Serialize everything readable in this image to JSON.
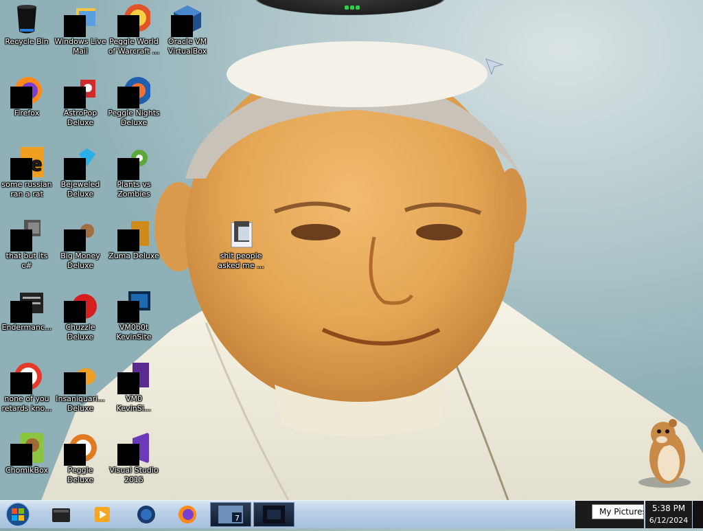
{
  "desktop": {
    "icons": [
      {
        "label": "Recycle Bin"
      },
      {
        "label": "Windows Live Mail"
      },
      {
        "label": "Peggle World of Warcraft ..."
      },
      {
        "label": "Oracle VM VirtualBox"
      },
      {
        "label": "Firefox"
      },
      {
        "label": "AstroPop Deluxe"
      },
      {
        "label": "Peggle Nights Deluxe"
      },
      {
        "label": "some russian ran a rat"
      },
      {
        "label": "Bejeweled Deluxe"
      },
      {
        "label": "Plants vs Zombies"
      },
      {
        "label": "that but its c#"
      },
      {
        "label": "Big Money Deluxe"
      },
      {
        "label": "Zuma Deluxe"
      },
      {
        "label": "Endermanc..."
      },
      {
        "label": "Chuzzle Deluxe"
      },
      {
        "label": "VM0b0t KevinSite"
      },
      {
        "label": "none of you retards kno..."
      },
      {
        "label": "Insaniquari... Deluxe"
      },
      {
        "label": "VM0 KevinSi..."
      },
      {
        "label": "ChomikBox"
      },
      {
        "label": "Peggle Deluxe"
      },
      {
        "label": "Visual Studio 2015"
      },
      {
        "label": "shit people asked me ..."
      }
    ]
  },
  "taskbar": {
    "pinned": [
      {
        "icon": "media-center-icon"
      },
      {
        "icon": "media-player-icon"
      },
      {
        "icon": "globe-icon"
      },
      {
        "icon": "firefox-icon"
      },
      {
        "icon": "vmware-icon"
      },
      {
        "icon": "terminal-icon"
      }
    ],
    "tooltip": "My Pictures",
    "clock": {
      "time": "5:38 PM",
      "date": "6/12/2024"
    }
  }
}
